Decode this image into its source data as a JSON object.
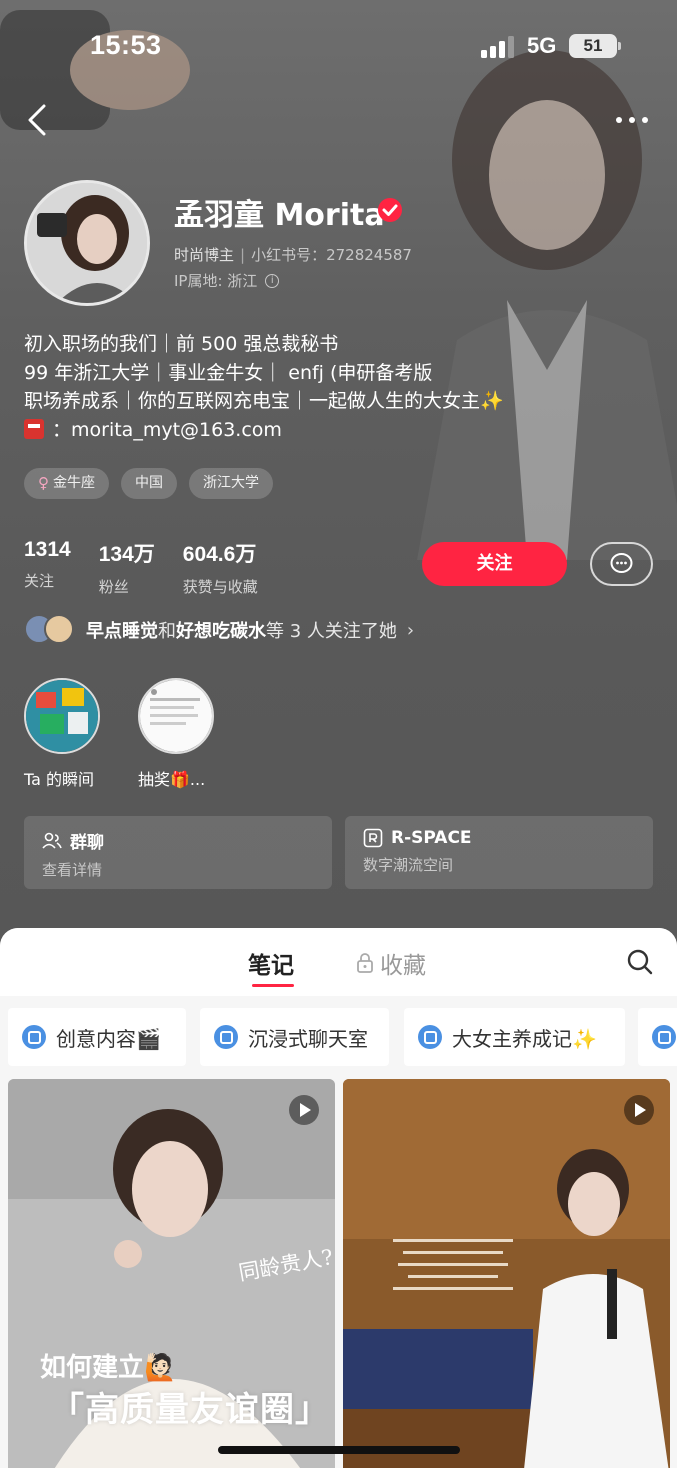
{
  "status": {
    "time": "15:53",
    "network": "5G",
    "battery": "51"
  },
  "profile": {
    "name": "孟羽童 Morita",
    "role": "时尚博主",
    "id_label": "小红书号：272824587",
    "ip_label": "IP属地: 浙江",
    "bio_lines": [
      "初入职场的我们｜前 500 强总裁秘书",
      "99 年浙江大学｜事业金牛女｜ enfj (申研备考版",
      "职场养成系｜你的互联网充电宝｜一起做人生的大女主✨"
    ],
    "email": "：morita_myt@163.com",
    "tags": [
      "金牛座",
      "中国",
      "浙江大学"
    ]
  },
  "stats": [
    {
      "num": "1314",
      "label": "关注"
    },
    {
      "num": "134万",
      "label": "粉丝"
    },
    {
      "num": "604.6万",
      "label": "获赞与收藏"
    }
  ],
  "actions": {
    "follow": "关注"
  },
  "mutual": {
    "user1": "早点睡觉",
    "and": " 和 ",
    "user2": "好想吃碳水",
    "suffix": " 等 3 人关注了她"
  },
  "moments": [
    {
      "label": "Ta 的瞬间"
    },
    {
      "label": "抽奖🎁..."
    }
  ],
  "cards": [
    {
      "title": "群聊",
      "sub": "查看详情"
    },
    {
      "title": "R-SPACE",
      "sub": "数字潮流空间"
    }
  ],
  "tabs": {
    "notes": "笔记",
    "favorites": "收藏"
  },
  "chips": [
    "创意内容🎬",
    "沉浸式聊天室",
    "大女主养成记✨"
  ],
  "posts": [
    {
      "overlay_small": "同龄贵人?",
      "overlay_top": "如何建立🙋🏻",
      "overlay_main": "「高质量友谊圈」"
    }
  ],
  "colors": {
    "accent": "#ff2442",
    "hero_bg": "#5a5a5a",
    "sheet_bg": "#f6f6f6",
    "chip_icon": "#4a90e2"
  }
}
